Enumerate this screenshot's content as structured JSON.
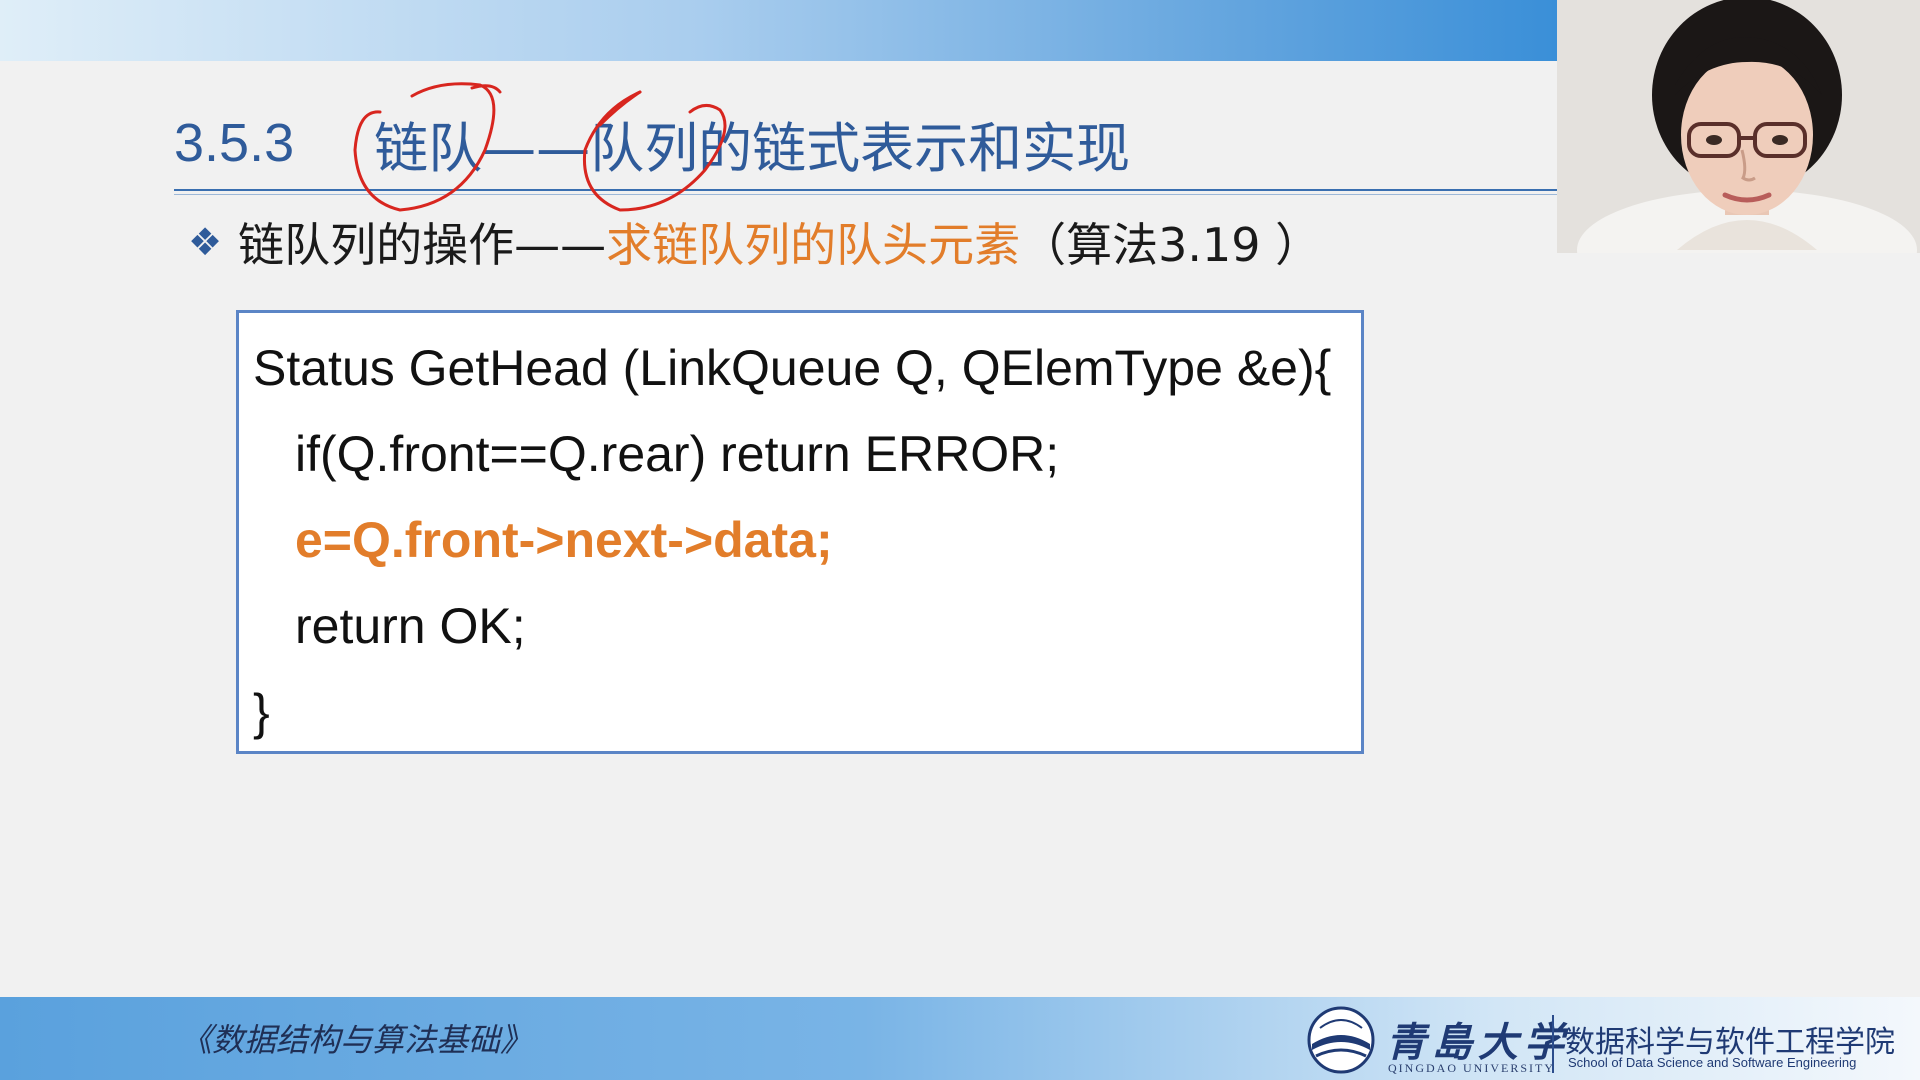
{
  "slide": {
    "section_number": "3.5.3",
    "section_title": "链队——队列的链式表示和实现",
    "bullet": {
      "prefix": "链队列的操作——",
      "highlight": "求链队列的队头元素",
      "suffix": "（算法3.19 ）"
    },
    "code": [
      {
        "text": "Status GetHead (LinkQueue Q, QElemType &e){",
        "highlight": false
      },
      {
        "text": "if(Q.front==Q.rear) return ERROR;",
        "highlight": false
      },
      {
        "text": "e=Q.front->next->data;",
        "highlight": true
      },
      {
        "text": "return OK;",
        "highlight": false
      },
      {
        "text": "}",
        "highlight": false
      }
    ]
  },
  "footer": {
    "course_title": "《数据结构与算法基础》",
    "university_cn": "青島大学",
    "university_en": "QINGDAO UNIVERSITY",
    "school_cn": "数据科学与软件工程学院",
    "school_en": "School of Data Science and Software Engineering"
  },
  "colors": {
    "accent_blue": "#2f5b9a",
    "highlight_orange": "#e27d2a",
    "annotation_red": "#d8261f",
    "code_border": "#5b85c6"
  },
  "icons": {
    "bullet": "diamond-bullet-icon",
    "webcam": "presenter-video"
  }
}
